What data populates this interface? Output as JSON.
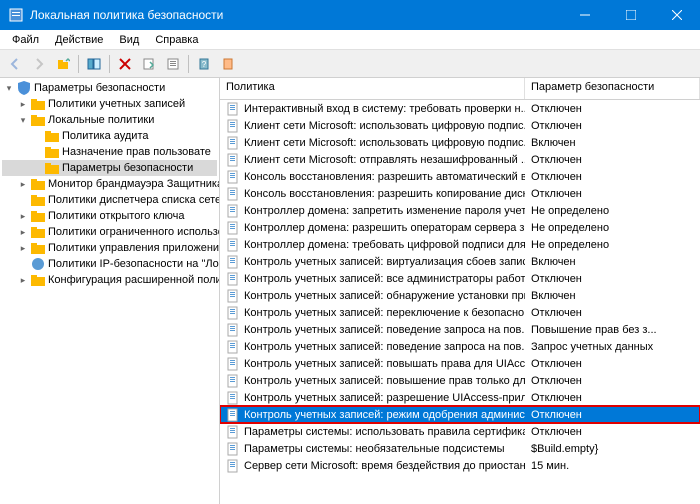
{
  "window": {
    "title": "Локальная политика безопасности"
  },
  "menu": {
    "file": "Файл",
    "action": "Действие",
    "view": "Вид",
    "help": "Справка"
  },
  "tree": {
    "root": "Параметры безопасности",
    "accountPolicies": "Политики учетных записей",
    "localPolicies": "Локальные политики",
    "auditPolicy": "Политика аудита",
    "userRights": "Назначение прав пользовате",
    "securityOptions": "Параметры безопасности",
    "firewall": "Монитор брандмауэра Защитника W",
    "networkList": "Политики диспетчера списка сетей",
    "publicKey": "Политики открытого ключа",
    "restrictedSoftware": "Политики ограниченного использов",
    "appControl": "Политики управления приложение",
    "ipSecurity": "Политики IP-безопасности на \"Лок",
    "advancedAudit": "Конфигурация расширенной полит"
  },
  "listHeader": {
    "policy": "Политика",
    "value": "Параметр безопасности"
  },
  "policies": [
    {
      "name": "Интерактивный вход в систему: требовать проверки н...",
      "value": "Отключен"
    },
    {
      "name": "Клиент сети Microsoft: использовать цифровую подпис...",
      "value": "Отключен"
    },
    {
      "name": "Клиент сети Microsoft: использовать цифровую подпис...",
      "value": "Включен"
    },
    {
      "name": "Клиент сети Microsoft: отправлять незашифрованный ...",
      "value": "Отключен"
    },
    {
      "name": "Консоль восстановления: разрешить автоматический вх...",
      "value": "Отключен"
    },
    {
      "name": "Консоль восстановления: разрешить копирование диск...",
      "value": "Отключен"
    },
    {
      "name": "Контроллер домена: запретить изменение пароля учетн...",
      "value": "Не определено"
    },
    {
      "name": "Контроллер домена: разрешить операторам сервера зад...",
      "value": "Не определено"
    },
    {
      "name": "Контроллер домена: требовать цифровой подписи для ...",
      "value": "Не определено"
    },
    {
      "name": "Контроль учетных записей: виртуализация сбоев запис...",
      "value": "Включен"
    },
    {
      "name": "Контроль учетных записей: все администраторы работа...",
      "value": "Отключен"
    },
    {
      "name": "Контроль учетных записей: обнаружение установки при...",
      "value": "Включен"
    },
    {
      "name": "Контроль учетных записей: переключение к безопасно...",
      "value": "Отключен"
    },
    {
      "name": "Контроль учетных записей: поведение запроса на пов...",
      "value": "Повышение прав без з..."
    },
    {
      "name": "Контроль учетных записей: поведение запроса на пов...",
      "value": "Запрос учетных данных"
    },
    {
      "name": "Контроль учетных записей: повышать права для UIAcc...",
      "value": "Отключен"
    },
    {
      "name": "Контроль учетных записей: повышение прав только для ...",
      "value": "Отключен"
    },
    {
      "name": "Контроль учетных записей: разрешение UIAccess-прило...",
      "value": "Отключен"
    },
    {
      "name": "Контроль учетных записей: режим одобрения админист...",
      "value": "Отключен",
      "selected": true,
      "highlighted": true
    },
    {
      "name": "Параметры системы: использовать правила сертификат...",
      "value": "Отключен"
    },
    {
      "name": "Параметры системы: необязательные подсистемы",
      "value": "$Build.empty}"
    },
    {
      "name": "Сервер сети Microsoft: время бездействия до приостан...",
      "value": "15 мин."
    }
  ]
}
